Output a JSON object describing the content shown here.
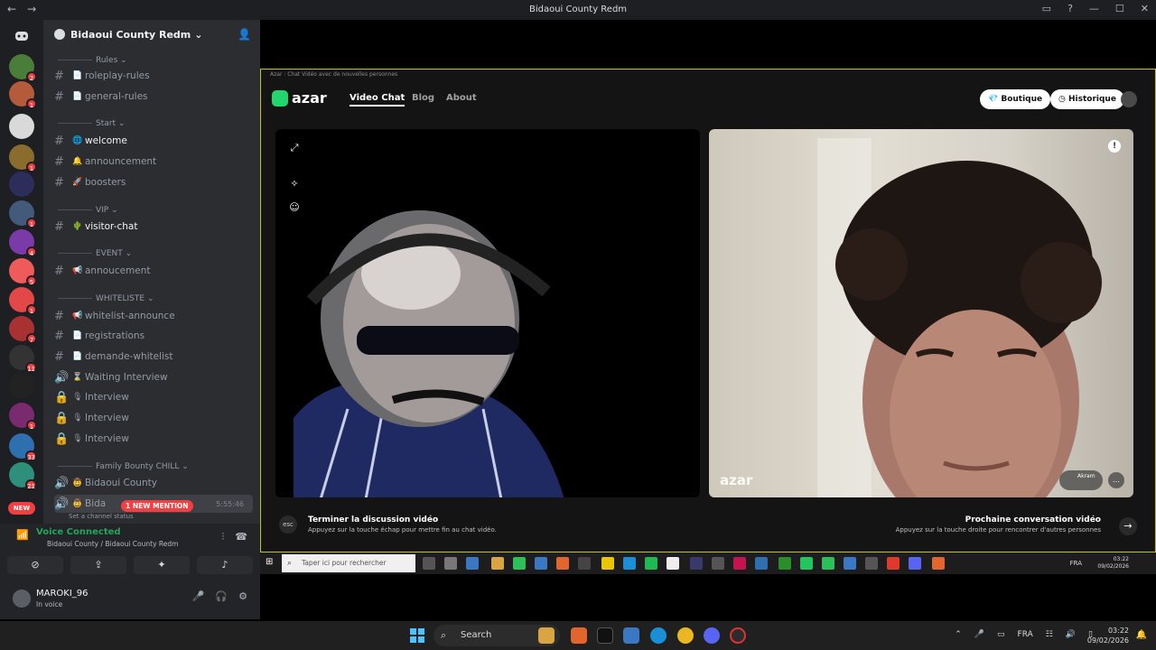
{
  "window": {
    "title": "Bidaoui County Redm"
  },
  "guild": {
    "name": "Bidaoui County Redm"
  },
  "categories": [
    "Rules",
    "Start",
    "VIP",
    "EVENT",
    "WHITELISTE",
    "Family Bounty CHILL"
  ],
  "channels": [
    {
      "icon": "#",
      "emoji": "📄",
      "name": "roleplay-rules"
    },
    {
      "icon": "#",
      "emoji": "📄",
      "name": "general-rules"
    },
    {
      "icon": "#",
      "emoji": "🌐",
      "name": "welcome"
    },
    {
      "icon": "#",
      "emoji": "🔔",
      "name": "announcement"
    },
    {
      "icon": "#",
      "emoji": "🚀",
      "name": "boosters"
    },
    {
      "icon": "#",
      "emoji": "🌵",
      "name": "visitor-chat"
    },
    {
      "icon": "#",
      "emoji": "📢",
      "name": "annoucement"
    },
    {
      "icon": "#",
      "emoji": "📢",
      "name": "whitelist-announce"
    },
    {
      "icon": "#",
      "emoji": "📄",
      "name": "registrations"
    },
    {
      "icon": "#",
      "emoji": "📄",
      "name": "demande-whitelist"
    },
    {
      "icon": "🔊",
      "emoji": "⌛",
      "name": "Waiting Interview"
    },
    {
      "icon": "🔒",
      "emoji": "🎙",
      "name": "Interview"
    },
    {
      "icon": "🔒",
      "emoji": "🎙",
      "name": "Interview"
    },
    {
      "icon": "🔒",
      "emoji": "🎙",
      "name": "Interview"
    },
    {
      "icon": "🔊",
      "emoji": "🤠",
      "name": "Bidaoui County"
    },
    {
      "icon": "🔊",
      "emoji": "🤠",
      "name": "Bida"
    }
  ],
  "active_voice": {
    "time": "5:55:46",
    "status_placeholder": "Set a channel status"
  },
  "new_mention": "1 NEW MENTION",
  "server_new": "NEW",
  "server_badges": [
    "2",
    "1",
    "",
    "1",
    "",
    "1",
    "4",
    "5",
    "1",
    "7",
    "11",
    "",
    "1",
    "33",
    "21"
  ],
  "voice": {
    "status": "Voice Connected",
    "location": "Bidaoui County / Bidaoui County Redm"
  },
  "user": {
    "name": "MAROKI_96",
    "status": "In voice"
  },
  "azar": {
    "window_title": "Azar : Chat Vidéo avec de nouvelles personnes",
    "logo": "azar",
    "nav": [
      "Video Chat",
      "Blog",
      "About"
    ],
    "shop": "Boutique",
    "history": "Historique",
    "watermark": "azar",
    "partner_name": "Akram",
    "footer_left": {
      "key": "esc",
      "title": "Terminer la discussion vidéo",
      "subtitle": "Appuyez sur la touche échap pour mettre fin au chat vidéo."
    },
    "footer_right": {
      "title": "Prochaine conversation vidéo",
      "subtitle": "Appuyez sur la touche droite pour rencontrer d'autres personnes"
    }
  },
  "inner_taskbar": {
    "search_placeholder": "Taper ici pour rechercher",
    "lang": "FRA",
    "time": "03:22",
    "date": "09/02/2026"
  },
  "taskbar": {
    "search": "Search",
    "lang": "FRA",
    "time": "03:22",
    "date": "09/02/2026"
  },
  "colors": {
    "discord_bg": "#2b2d31",
    "azar_green": "#22d66c",
    "mention_red": "#f23f42",
    "window_border": "#c8c800"
  }
}
